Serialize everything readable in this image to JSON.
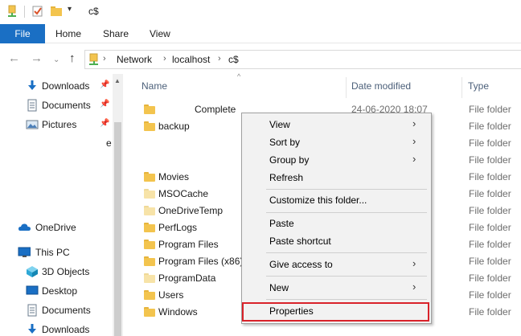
{
  "window": {
    "title": "c$",
    "quick_access_icons": [
      "properties-icon",
      "checkmark-doc-icon",
      "new-folder-icon",
      "customize-dropdown-icon"
    ]
  },
  "ribbon": {
    "tabs": [
      "File",
      "Home",
      "Share",
      "View"
    ]
  },
  "address": {
    "back_icon": "arrow-left-icon",
    "forward_icon": "arrow-right-icon",
    "recent_icon": "chevron-down-icon",
    "up_icon": "arrow-up-icon",
    "path": [
      "Network",
      "localhost",
      "c$"
    ]
  },
  "navpane": {
    "items": [
      {
        "label": "Downloads",
        "icon": "download-icon",
        "pinned": true
      },
      {
        "label": "Documents",
        "icon": "documents-icon",
        "pinned": true
      },
      {
        "label": "Pictures",
        "icon": "pictures-icon",
        "pinned": true
      },
      {
        "label": "e",
        "icon": "",
        "pinned": false
      },
      {
        "label": "OneDrive",
        "icon": "onedrive-icon",
        "pinned": false
      },
      {
        "label": "This PC",
        "icon": "pc-icon",
        "pinned": false
      },
      {
        "label": "3D Objects",
        "icon": "3d-objects-icon",
        "pinned": false
      },
      {
        "label": "Desktop",
        "icon": "desktop-icon",
        "pinned": false
      },
      {
        "label": "Documents",
        "icon": "documents-icon",
        "pinned": false
      },
      {
        "label": "Downloads",
        "icon": "download-icon",
        "pinned": false
      }
    ]
  },
  "files": {
    "columns": {
      "name": "Name",
      "date": "Date modified",
      "type": "Type"
    },
    "rows": [
      {
        "name": "Complete",
        "date": "24-06-2020 18:07",
        "type": "File folder",
        "style": "normal"
      },
      {
        "name": "backup",
        "date": "",
        "type": "File folder",
        "style": "normal"
      },
      {
        "name": "",
        "date": "",
        "type": "File folder",
        "style": "none"
      },
      {
        "name": "",
        "date": "",
        "type": "File folder",
        "style": "none"
      },
      {
        "name": "Movies",
        "date": "",
        "type": "File folder",
        "style": "normal"
      },
      {
        "name": "MSOCache",
        "date": "",
        "type": "File folder",
        "style": "faded"
      },
      {
        "name": "OneDriveTemp",
        "date": "",
        "type": "File folder",
        "style": "faded"
      },
      {
        "name": "PerfLogs",
        "date": "",
        "type": "File folder",
        "style": "normal"
      },
      {
        "name": "Program Files",
        "date": "",
        "type": "File folder",
        "style": "normal"
      },
      {
        "name": "Program Files (x86)",
        "date": "",
        "type": "File folder",
        "style": "normal"
      },
      {
        "name": "ProgramData",
        "date": "",
        "type": "File folder",
        "style": "faded"
      },
      {
        "name": "Users",
        "date": "",
        "type": "File folder",
        "style": "normal"
      },
      {
        "name": "Windows",
        "date": "",
        "type": "File folder",
        "style": "normal"
      }
    ]
  },
  "context_menu": {
    "items": [
      {
        "label": "View",
        "submenu": true
      },
      {
        "label": "Sort by",
        "submenu": true
      },
      {
        "label": "Group by",
        "submenu": true
      },
      {
        "label": "Refresh",
        "submenu": false
      },
      {
        "label": "Customize this folder...",
        "submenu": false
      },
      {
        "label": "Paste",
        "submenu": false
      },
      {
        "label": "Paste shortcut",
        "submenu": false
      },
      {
        "label": "Give access to",
        "submenu": true
      },
      {
        "label": "New",
        "submenu": true
      },
      {
        "label": "Properties",
        "submenu": false,
        "highlighted": true
      }
    ]
  },
  "colors": {
    "accent": "#1a6fc4",
    "folder": "#f3c44e",
    "folder_faded": "#f7e3a8",
    "highlight_border": "#d9222a"
  }
}
